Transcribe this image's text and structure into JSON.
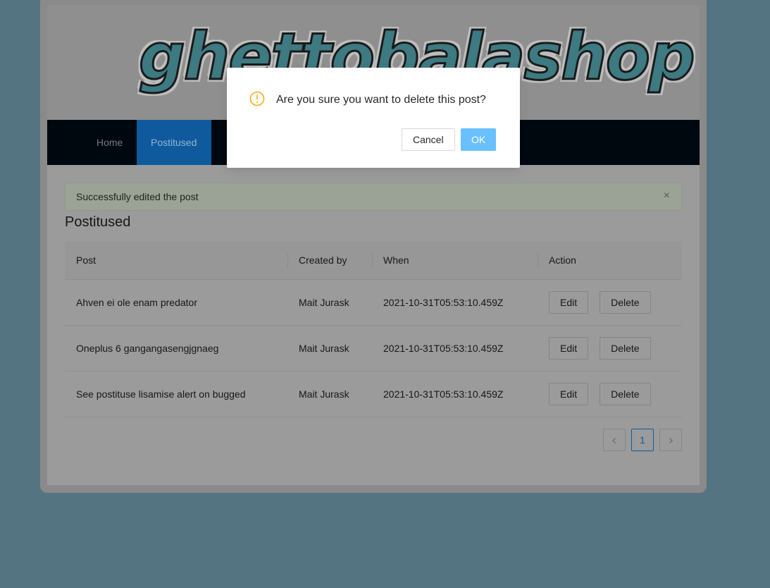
{
  "header": {
    "logo_text": "ghettobalashop"
  },
  "nav": {
    "items": [
      {
        "label": "Home"
      },
      {
        "label": "Postitused"
      },
      {
        "label": ""
      }
    ]
  },
  "alert": {
    "message": "Successfully edited the post",
    "close_icon": "close-icon",
    "close_glyph": "×"
  },
  "main": {
    "title": "Postitused",
    "table": {
      "columns": [
        "Post",
        "Created by",
        "When",
        "Action"
      ],
      "rows": [
        {
          "post": "Ahven ei ole enam predator",
          "created_by": "Mait Jurask",
          "when": "2021-10-31T05:53:10.459Z"
        },
        {
          "post": "Oneplus 6 gangangasengjgnaeg",
          "created_by": "Mait Jurask",
          "when": "2021-10-31T05:53:10.459Z"
        },
        {
          "post": "See postituse lisamise alert on bugged",
          "created_by": "Mait Jurask",
          "when": "2021-10-31T05:53:10.459Z"
        }
      ],
      "edit_label": "Edit",
      "delete_label": "Delete"
    },
    "pagination": {
      "current_page": "1",
      "prev_icon": "chevron-left-icon",
      "next_icon": "chevron-right-icon"
    }
  },
  "modal": {
    "icon": "exclamation-circle-icon",
    "message": "Are you sure you want to delete this post?",
    "cancel_label": "Cancel",
    "ok_label": "OK"
  },
  "colors": {
    "backdrop": "#557482",
    "nav_background": "#00080f",
    "nav_active": "#0e5a9c",
    "warning_icon": "#faad14",
    "ok_button": "#69c0ff"
  }
}
